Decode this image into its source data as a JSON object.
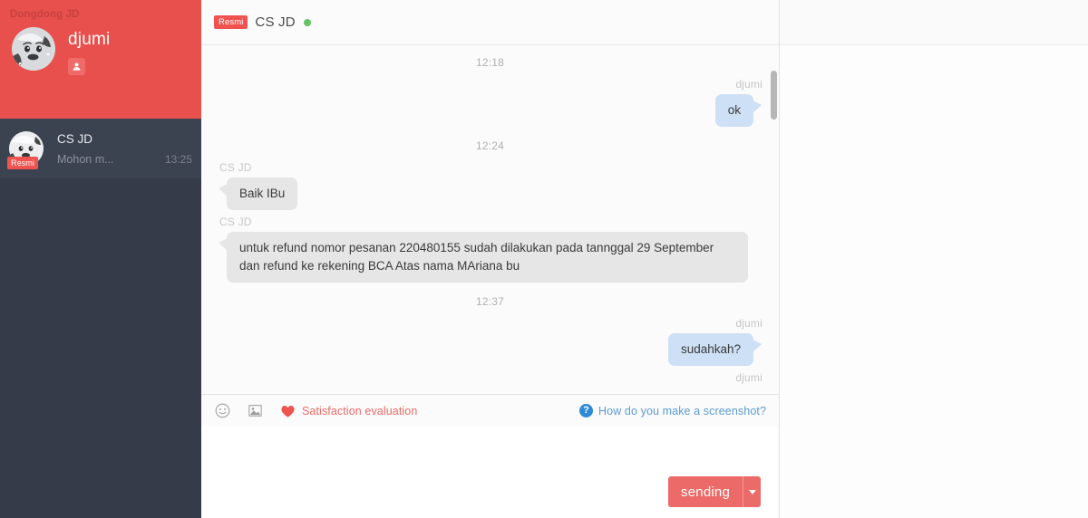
{
  "sidebar": {
    "brand": "Dongdong JD",
    "profile": {
      "name": "djumi",
      "avatar_icon": "user-avatar-cartoon-face",
      "role_icon": "person-badge-icon"
    },
    "conversations": [
      {
        "name": "CS JD",
        "badge": "Resmi",
        "preview": "Mohon m...",
        "time": "13:25",
        "avatar_icon": "cs-avatar-cartoon-face"
      }
    ]
  },
  "chat": {
    "header": {
      "badge": "Resmi",
      "title": "CS JD",
      "status_icon": "online-dot",
      "status_color": "#62c462"
    },
    "messages": [
      {
        "kind": "timestamp",
        "text": "12:18"
      },
      {
        "kind": "message",
        "direction": "out",
        "sender": "djumi",
        "text": "ok"
      },
      {
        "kind": "timestamp",
        "text": "12:24"
      },
      {
        "kind": "message",
        "direction": "in",
        "sender": "CS JD",
        "text": "Baik IBu"
      },
      {
        "kind": "message",
        "direction": "in",
        "sender": "CS JD",
        "text": "untuk refund nomor pesanan 220480155 sudah dilakukan pada tannggal 29 September dan refund ke rekening BCA Atas nama MAriana bu"
      },
      {
        "kind": "timestamp",
        "text": "12:37"
      },
      {
        "kind": "message",
        "direction": "out",
        "sender": "djumi",
        "text": "sudahkah?"
      },
      {
        "kind": "sender-only",
        "direction": "out",
        "sender": "djumi"
      }
    ],
    "toolbar": {
      "emoji_icon": "smiley-icon",
      "image_icon": "image-icon",
      "heart_icon": "heart-icon",
      "satisfaction_label": "Satisfaction evaluation",
      "help_icon": "question-mark-icon",
      "help_label": "How do you make a screenshot?"
    },
    "composer": {
      "value": "",
      "placeholder": "",
      "send_label": "sending",
      "dropdown_icon": "chevron-down-icon"
    }
  },
  "colors": {
    "brand_red": "#e8504d",
    "accent_red": "#ec6a67",
    "sidebar_dark": "#353b48",
    "bubble_out": "#cde0f5",
    "bubble_in": "#e6e6e6",
    "link_blue": "#5b9bd5"
  }
}
